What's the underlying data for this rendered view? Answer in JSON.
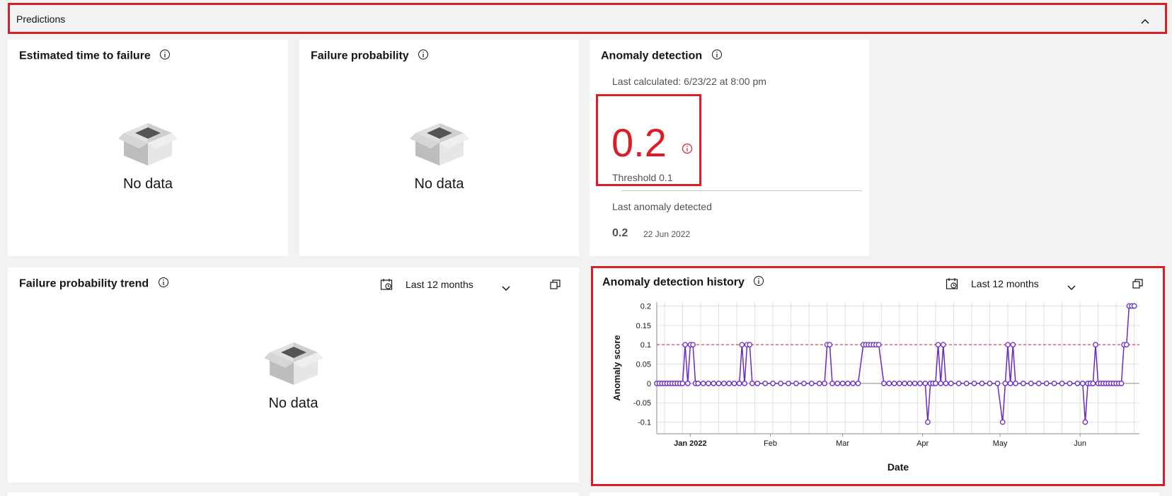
{
  "accordion": {
    "title": "Predictions"
  },
  "tiles": {
    "ettf": {
      "title": "Estimated time to failure",
      "empty": "No data"
    },
    "failprob": {
      "title": "Failure probability",
      "empty": "No data"
    },
    "anomaly": {
      "title": "Anomaly detection",
      "last_calculated": "Last calculated: 6/23/22 at 8:00 pm",
      "score": "0.2",
      "threshold": "Threshold 0.1",
      "last_detected_label": "Last anomaly detected",
      "last_value": "0.2",
      "last_date": "22 Jun 2022"
    },
    "trend": {
      "title": "Failure probability trend",
      "range": "Last 12 months",
      "empty": "No data"
    },
    "history": {
      "title": "Anomaly detection history",
      "range": "Last 12 months"
    }
  },
  "chart_data": {
    "type": "line",
    "title": "",
    "xlabel": "Date",
    "ylabel": "Anomaly score",
    "x_ticks": [
      "Jan 2022",
      "Feb",
      "Mar",
      "Apr",
      "May",
      "Jun"
    ],
    "y_ticks": [
      "0.2",
      "0.15",
      "0.1",
      "0.05",
      "0",
      "-0.05",
      "-0.1"
    ],
    "ylim": [
      -0.13,
      0.21
    ],
    "xlim": [
      "2021-12-19",
      "2022-06-24"
    ],
    "threshold": 0.1,
    "series_color": "#6929c4",
    "threshold_color": "#da1e28",
    "grid": true,
    "series": [
      {
        "points": [
          {
            "x": "2021-12-19",
            "y": 0
          },
          {
            "x": "2021-12-20",
            "y": 0
          },
          {
            "x": "2021-12-21",
            "y": 0
          },
          {
            "x": "2021-12-22",
            "y": 0
          },
          {
            "x": "2021-12-23",
            "y": 0
          },
          {
            "x": "2021-12-24",
            "y": 0
          },
          {
            "x": "2021-12-25",
            "y": 0
          },
          {
            "x": "2021-12-26",
            "y": 0
          },
          {
            "x": "2021-12-27",
            "y": 0
          },
          {
            "x": "2021-12-28",
            "y": 0
          },
          {
            "x": "2021-12-29",
            "y": 0
          },
          {
            "x": "2021-12-30",
            "y": 0.1
          },
          {
            "x": "2021-12-31",
            "y": 0
          },
          {
            "x": "2022-01-01",
            "y": 0.1
          },
          {
            "x": "2022-01-02",
            "y": 0.1
          },
          {
            "x": "2022-01-03",
            "y": 0
          },
          {
            "x": "2022-01-04",
            "y": 0
          },
          {
            "x": "2022-01-06",
            "y": 0
          },
          {
            "x": "2022-01-08",
            "y": 0
          },
          {
            "x": "2022-01-10",
            "y": 0
          },
          {
            "x": "2022-01-12",
            "y": 0
          },
          {
            "x": "2022-01-14",
            "y": 0
          },
          {
            "x": "2022-01-16",
            "y": 0
          },
          {
            "x": "2022-01-18",
            "y": 0
          },
          {
            "x": "2022-01-20",
            "y": 0
          },
          {
            "x": "2022-01-21",
            "y": 0.1
          },
          {
            "x": "2022-01-22",
            "y": 0
          },
          {
            "x": "2022-01-23",
            "y": 0.1
          },
          {
            "x": "2022-01-24",
            "y": 0.1
          },
          {
            "x": "2022-01-25",
            "y": 0
          },
          {
            "x": "2022-01-27",
            "y": 0
          },
          {
            "x": "2022-01-30",
            "y": 0
          },
          {
            "x": "2022-02-02",
            "y": 0
          },
          {
            "x": "2022-02-05",
            "y": 0
          },
          {
            "x": "2022-02-08",
            "y": 0
          },
          {
            "x": "2022-02-11",
            "y": 0
          },
          {
            "x": "2022-02-14",
            "y": 0
          },
          {
            "x": "2022-02-17",
            "y": 0
          },
          {
            "x": "2022-02-20",
            "y": 0
          },
          {
            "x": "2022-02-22",
            "y": 0
          },
          {
            "x": "2022-02-23",
            "y": 0.1
          },
          {
            "x": "2022-02-24",
            "y": 0.1
          },
          {
            "x": "2022-02-25",
            "y": 0
          },
          {
            "x": "2022-02-27",
            "y": 0
          },
          {
            "x": "2022-03-01",
            "y": 0
          },
          {
            "x": "2022-03-03",
            "y": 0
          },
          {
            "x": "2022-03-05",
            "y": 0
          },
          {
            "x": "2022-03-07",
            "y": 0
          },
          {
            "x": "2022-03-09",
            "y": 0.1
          },
          {
            "x": "2022-03-10",
            "y": 0.1
          },
          {
            "x": "2022-03-11",
            "y": 0.1
          },
          {
            "x": "2022-03-12",
            "y": 0.1
          },
          {
            "x": "2022-03-13",
            "y": 0.1
          },
          {
            "x": "2022-03-14",
            "y": 0.1
          },
          {
            "x": "2022-03-15",
            "y": 0.1
          },
          {
            "x": "2022-03-17",
            "y": 0
          },
          {
            "x": "2022-03-19",
            "y": 0
          },
          {
            "x": "2022-03-21",
            "y": 0
          },
          {
            "x": "2022-03-23",
            "y": 0
          },
          {
            "x": "2022-03-25",
            "y": 0
          },
          {
            "x": "2022-03-27",
            "y": 0
          },
          {
            "x": "2022-03-29",
            "y": 0
          },
          {
            "x": "2022-03-31",
            "y": 0
          },
          {
            "x": "2022-04-02",
            "y": 0
          },
          {
            "x": "2022-04-03",
            "y": -0.1
          },
          {
            "x": "2022-04-04",
            "y": 0
          },
          {
            "x": "2022-04-05",
            "y": 0
          },
          {
            "x": "2022-04-06",
            "y": 0
          },
          {
            "x": "2022-04-07",
            "y": 0.1
          },
          {
            "x": "2022-04-08",
            "y": 0
          },
          {
            "x": "2022-04-09",
            "y": 0.1
          },
          {
            "x": "2022-04-10",
            "y": 0
          },
          {
            "x": "2022-04-12",
            "y": 0
          },
          {
            "x": "2022-04-15",
            "y": 0
          },
          {
            "x": "2022-04-18",
            "y": 0
          },
          {
            "x": "2022-04-21",
            "y": 0
          },
          {
            "x": "2022-04-24",
            "y": 0
          },
          {
            "x": "2022-04-27",
            "y": 0
          },
          {
            "x": "2022-04-30",
            "y": 0
          },
          {
            "x": "2022-05-02",
            "y": -0.1
          },
          {
            "x": "2022-05-03",
            "y": 0
          },
          {
            "x": "2022-05-04",
            "y": 0.1
          },
          {
            "x": "2022-05-05",
            "y": 0
          },
          {
            "x": "2022-05-06",
            "y": 0.1
          },
          {
            "x": "2022-05-07",
            "y": 0
          },
          {
            "x": "2022-05-10",
            "y": 0
          },
          {
            "x": "2022-05-13",
            "y": 0
          },
          {
            "x": "2022-05-16",
            "y": 0
          },
          {
            "x": "2022-05-19",
            "y": 0
          },
          {
            "x": "2022-05-22",
            "y": 0
          },
          {
            "x": "2022-05-25",
            "y": 0
          },
          {
            "x": "2022-05-28",
            "y": 0
          },
          {
            "x": "2022-05-31",
            "y": 0
          },
          {
            "x": "2022-06-02",
            "y": 0
          },
          {
            "x": "2022-06-03",
            "y": -0.1
          },
          {
            "x": "2022-06-04",
            "y": 0
          },
          {
            "x": "2022-06-05",
            "y": 0
          },
          {
            "x": "2022-06-06",
            "y": 0
          },
          {
            "x": "2022-06-07",
            "y": 0.1
          },
          {
            "x": "2022-06-08",
            "y": 0
          },
          {
            "x": "2022-06-09",
            "y": 0
          },
          {
            "x": "2022-06-10",
            "y": 0
          },
          {
            "x": "2022-06-11",
            "y": 0
          },
          {
            "x": "2022-06-12",
            "y": 0
          },
          {
            "x": "2022-06-13",
            "y": 0
          },
          {
            "x": "2022-06-14",
            "y": 0
          },
          {
            "x": "2022-06-15",
            "y": 0
          },
          {
            "x": "2022-06-16",
            "y": 0
          },
          {
            "x": "2022-06-17",
            "y": 0
          },
          {
            "x": "2022-06-18",
            "y": 0.1
          },
          {
            "x": "2022-06-19",
            "y": 0.1
          },
          {
            "x": "2022-06-20",
            "y": 0.2
          },
          {
            "x": "2022-06-21",
            "y": 0.2
          },
          {
            "x": "2022-06-22",
            "y": 0.2
          }
        ]
      }
    ]
  }
}
